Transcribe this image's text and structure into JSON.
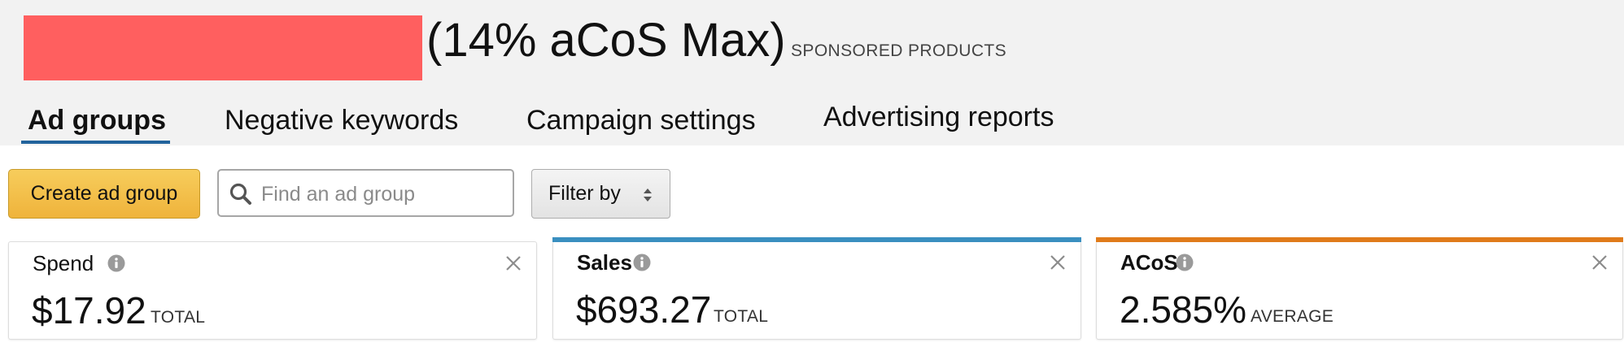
{
  "header": {
    "campaign_title": "(14% aCoS Max)",
    "campaign_type": "SPONSORED PRODUCTS"
  },
  "tabs": [
    {
      "label": "Ad groups",
      "active": true
    },
    {
      "label": "Negative keywords",
      "active": false
    },
    {
      "label": "Campaign settings",
      "active": false
    },
    {
      "label": "Advertising reports",
      "active": false
    }
  ],
  "toolbar": {
    "create_label": "Create ad group",
    "search_placeholder": "Find an ad group",
    "search_value": "",
    "filter_label": "Filter by"
  },
  "metrics": [
    {
      "name": "Spend",
      "value": "$17.92",
      "unit": "TOTAL",
      "accent": ""
    },
    {
      "name": "Sales",
      "value": "$693.27",
      "unit": "TOTAL",
      "accent": "#3a8fc0"
    },
    {
      "name": "ACoS",
      "value": "2.585%",
      "unit": "AVERAGE",
      "accent": "#e07b1a"
    }
  ],
  "colors": {
    "redacted_block": "#ff5f5f",
    "primary_button": "#f2c046",
    "tab_underline": "#22639c"
  },
  "icons": {
    "search": "search-icon",
    "filter": "sort-caret-icon",
    "info": "info-icon",
    "close": "close-icon"
  }
}
